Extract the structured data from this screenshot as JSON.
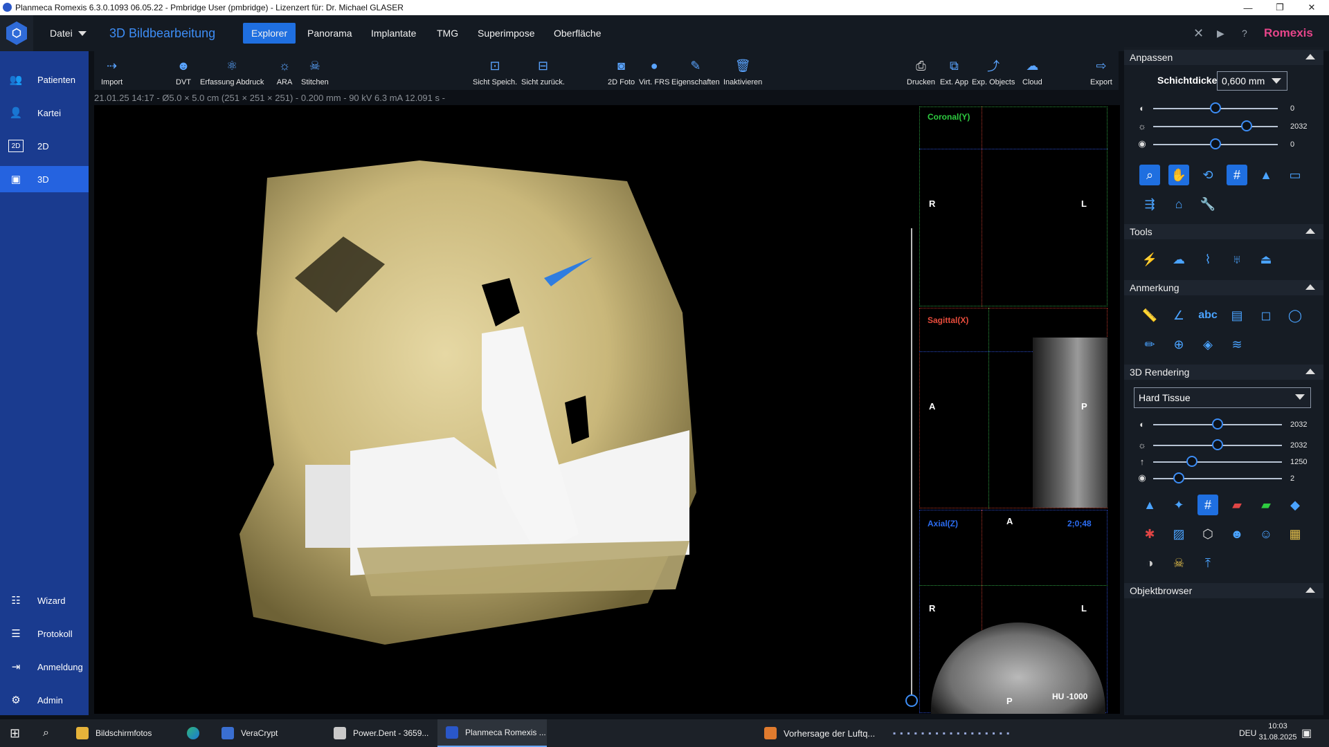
{
  "window": {
    "title": "Planmeca Romexis 6.3.0.1093 06.05.22 - Pmbridge User (pmbridge) - Lizenzert für: Dr. Michael GLASER"
  },
  "menubar": {
    "file_label": "Datei",
    "app_title": "3D Bildbearbeitung",
    "tabs": [
      {
        "label": "Explorer",
        "active": true
      },
      {
        "label": "Panorama",
        "active": false
      },
      {
        "label": "Implantate",
        "active": false
      },
      {
        "label": "TMG",
        "active": false
      },
      {
        "label": "Superimpose",
        "active": false
      },
      {
        "label": "Oberfläche",
        "active": false
      }
    ],
    "brand": "Romexis"
  },
  "sidebar": {
    "items": [
      {
        "label": "Patienten",
        "icon": "patients-icon"
      },
      {
        "label": "Kartei",
        "icon": "person-icon"
      },
      {
        "label": "2D",
        "icon": "2d-icon"
      },
      {
        "label": "3D",
        "icon": "3d-icon",
        "active": true
      }
    ],
    "bottom_items": [
      {
        "label": "Wizard",
        "icon": "wizard-icon"
      },
      {
        "label": "Protokoll",
        "icon": "protocol-icon"
      },
      {
        "label": "Anmeldung",
        "icon": "login-icon"
      },
      {
        "label": "Admin",
        "icon": "admin-icon"
      }
    ]
  },
  "toolbar": {
    "buttons": [
      {
        "label": "Import",
        "icon": "import-icon"
      },
      {
        "label": "DVT",
        "icon": "dvt-icon"
      },
      {
        "label": "Erfassung Abdruck",
        "icon": "impression-icon"
      },
      {
        "label": "ARA",
        "icon": "ara-icon"
      },
      {
        "label": "Stitchen",
        "icon": "stitch-icon"
      },
      {
        "label": "Sicht Speich.",
        "icon": "save-view-icon"
      },
      {
        "label": "Sicht zurück.",
        "icon": "restore-view-icon"
      },
      {
        "label": "2D Foto",
        "icon": "camera-icon"
      },
      {
        "label": "Virt. FRS",
        "icon": "virtual-frs-icon"
      },
      {
        "label": "Eigenschaften",
        "icon": "properties-icon"
      },
      {
        "label": "Inaktivieren",
        "icon": "deactivate-icon"
      },
      {
        "label": "Drucken",
        "icon": "print-icon"
      },
      {
        "label": "Ext. App",
        "icon": "external-app-icon"
      },
      {
        "label": "Exp. Objects",
        "icon": "export-objects-icon"
      },
      {
        "label": "Cloud",
        "icon": "cloud-icon"
      },
      {
        "label": "Export",
        "icon": "export-icon"
      }
    ]
  },
  "info_strip": "21.01.25 14:17 - Ø5.0 × 5.0 cm (251 × 251 × 251) - 0.200 mm - 90 kV 6.3 mA 12.091 s -",
  "views": {
    "coronal": {
      "label": "Coronal(Y)",
      "left": "R",
      "right": "L"
    },
    "sagittal": {
      "label": "Sagittal(X)",
      "left": "A",
      "right": "P"
    },
    "axial": {
      "label": "Axial(Z)",
      "top": "A",
      "coords": "2;0;48",
      "left": "R",
      "right": "L",
      "bottom": "P",
      "hu": "HU -1000"
    }
  },
  "panel": {
    "anpassen": {
      "title": "Anpassen",
      "schichtdicke_label": "Schichtdicke",
      "schichtdicke_value": "0,600 mm",
      "sliders": [
        {
          "icon": "contrast-icon",
          "value": "0",
          "level": 0.5
        },
        {
          "icon": "brightness-icon",
          "value": "2032",
          "level": 0.75
        },
        {
          "icon": "gamma-icon",
          "value": "0",
          "level": 0.5
        }
      ]
    },
    "tools": {
      "title": "Tools"
    },
    "anmerkung": {
      "title": "Anmerkung",
      "text_tool": "abc"
    },
    "rendering": {
      "title": "3D Rendering",
      "preset": "Hard Tissue",
      "sliders": [
        {
          "icon": "contrast-icon",
          "value": "2032",
          "level": 0.5
        },
        {
          "icon": "brightness-icon",
          "value": "2032",
          "level": 0.5
        },
        {
          "icon": "threshold-icon",
          "value": "1250",
          "level": 0.3
        },
        {
          "icon": "opacity-icon",
          "value": "2",
          "level": 0.2
        }
      ]
    },
    "objektbrowser": {
      "title": "Objektbrowser"
    }
  },
  "taskbar": {
    "items": [
      {
        "label": "Bildschirmfotos"
      },
      {
        "label": "VeraCrypt"
      },
      {
        "label": "Power.Dent - 3659..."
      },
      {
        "label": "Planmeca Romexis ..."
      }
    ],
    "weather": "Vorhersage der Luftq...",
    "language": "DEU",
    "time": "10:03",
    "date": "31.08.2025"
  }
}
